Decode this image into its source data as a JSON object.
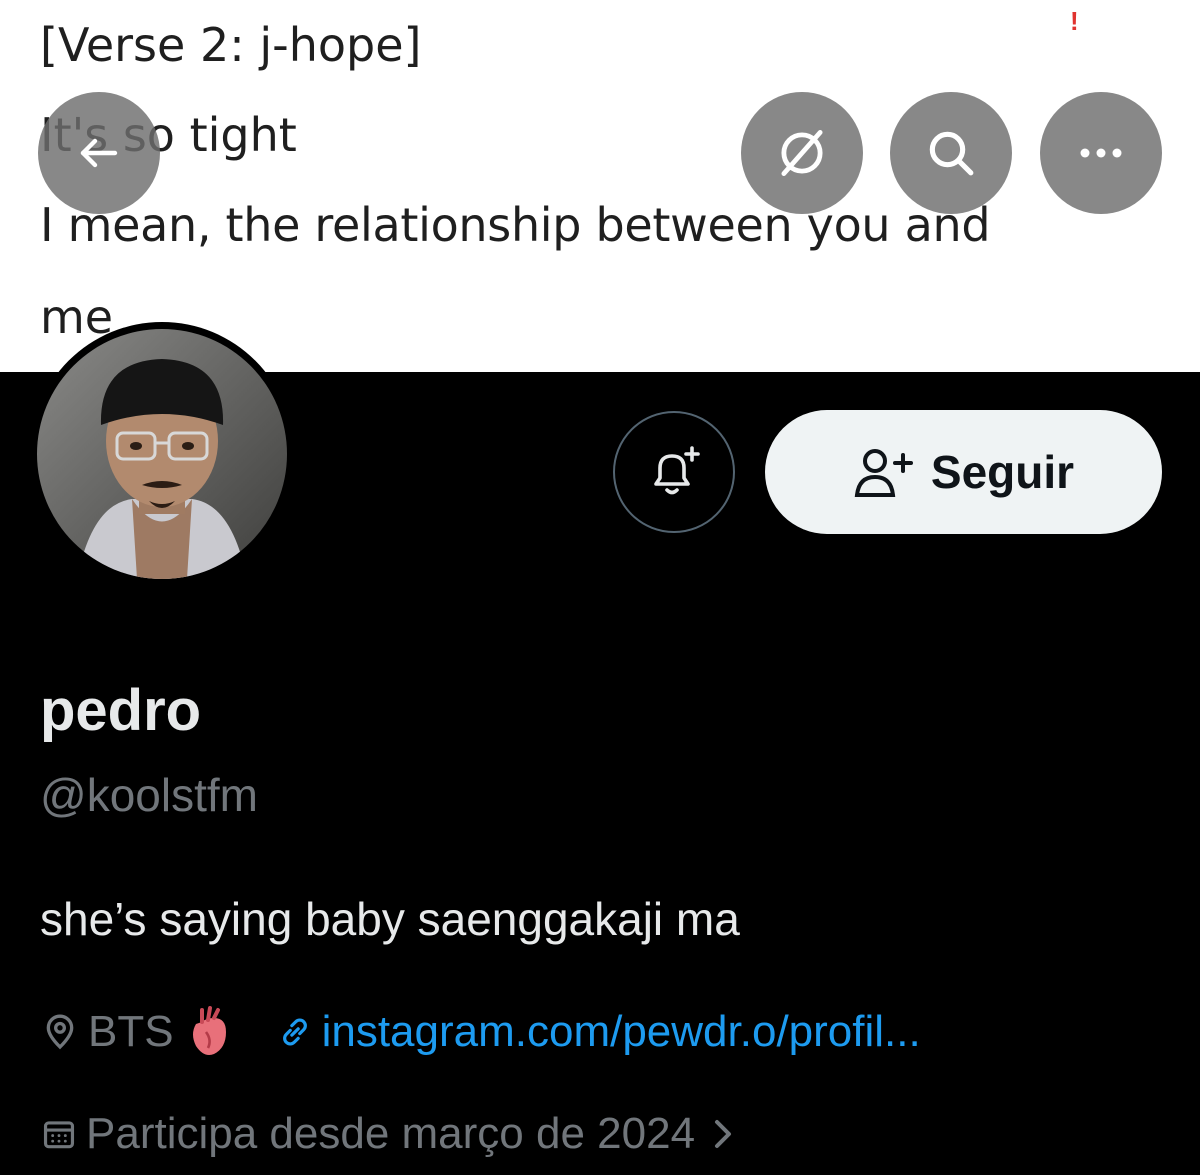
{
  "banner": {
    "lyrics": [
      "[Verse 2: j-hope]",
      "It's so tight",
      "I mean, the relationship between you and",
      "me"
    ],
    "alert_mark": "!"
  },
  "profile": {
    "name": "pedro",
    "handle": "@koolstfm",
    "bio": "she’s saying baby saenggakaji ma",
    "location": "BTS",
    "link": "instagram.com/pewdr.o/profil...",
    "joined": "Participa desde março de 2024",
    "follow_label": "Seguir"
  },
  "colors": {
    "background": "#000000",
    "link": "#1d9bf0",
    "secondary_text": "#71767b",
    "primary_text": "#e7e9ea",
    "follow_button_bg": "#eff3f4"
  },
  "icons": [
    "back-arrow-icon",
    "grok-icon",
    "search-icon",
    "more-icon",
    "bell-plus-icon",
    "follow-user-icon",
    "location-icon",
    "anatomical-heart-icon",
    "link-icon",
    "calendar-icon",
    "chevron-right-icon"
  ]
}
